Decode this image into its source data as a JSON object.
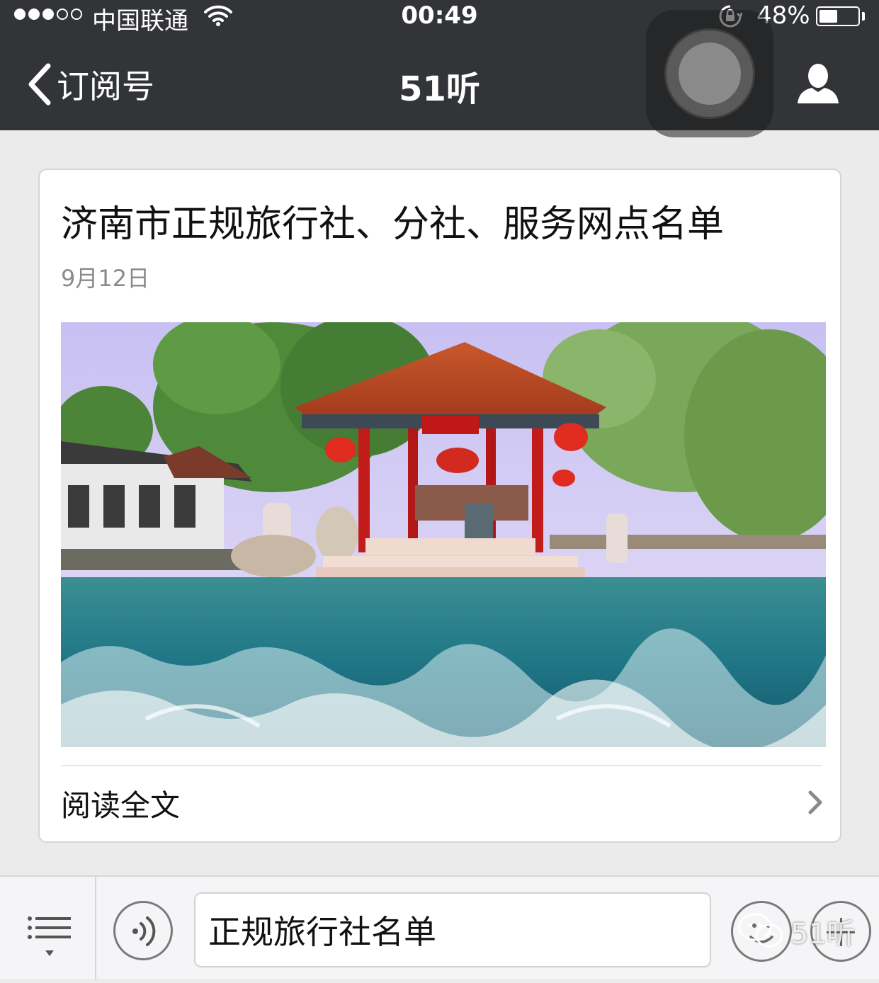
{
  "status_bar": {
    "carrier": "中国联通",
    "time": "00:49",
    "battery_percent_label": "48%",
    "battery_level": 0.48,
    "signal_strength": 3,
    "signal_max": 5
  },
  "nav": {
    "back_label": "订阅号",
    "title": "51听"
  },
  "article": {
    "title": "济南市正规旅行社、分社、服务网点名单",
    "date": "9月12日",
    "read_more_label": "阅读全文"
  },
  "input_bar": {
    "text": "正规旅行社名单"
  },
  "watermark": {
    "text": "51听"
  },
  "colors": {
    "nav_bg": "#323437",
    "page_bg": "#ebebeb",
    "card_bg": "#ffffff",
    "date_gray": "#8a8a8a"
  }
}
